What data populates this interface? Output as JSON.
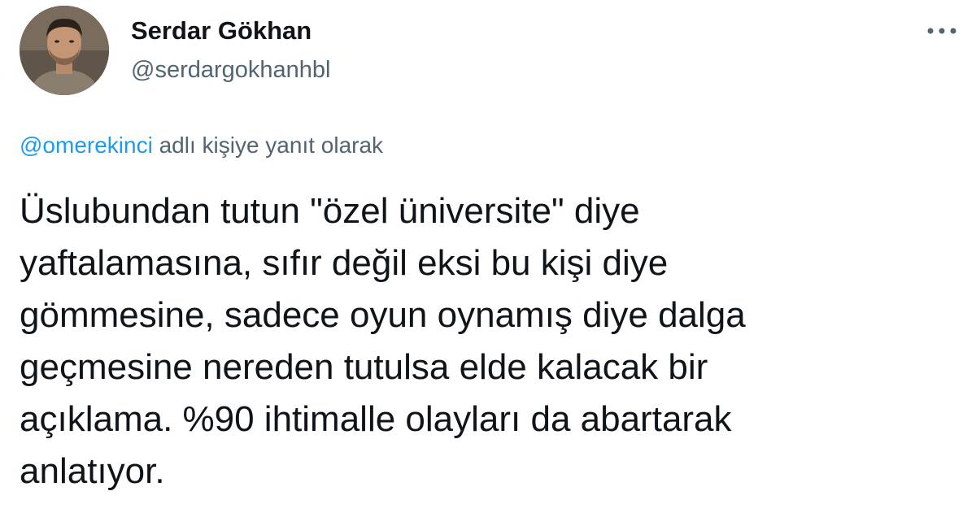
{
  "author": {
    "display_name": "Serdar Gökhan",
    "handle": "@serdargokhanhbl"
  },
  "more_icon": "more-horizontal-icon",
  "reply": {
    "mention": "@omerekinci",
    "suffix": " adlı kişiye yanıt olarak"
  },
  "tweet": {
    "lines": [
      "Üslubundan tutun \"özel üniversite\" diye",
      "yaftalamasına, sıfır değil eksi bu kişi diye",
      "gömmesine, sadece oyun oynamış diye dalga",
      "geçmesine nereden tutulsa elde kalacak bir",
      "açıklama. %90 ihtimalle olayları da abartarak",
      "anlatıyor."
    ]
  },
  "colors": {
    "text": "#0f1419",
    "secondary": "#536471",
    "link": "#1d9bf0"
  }
}
